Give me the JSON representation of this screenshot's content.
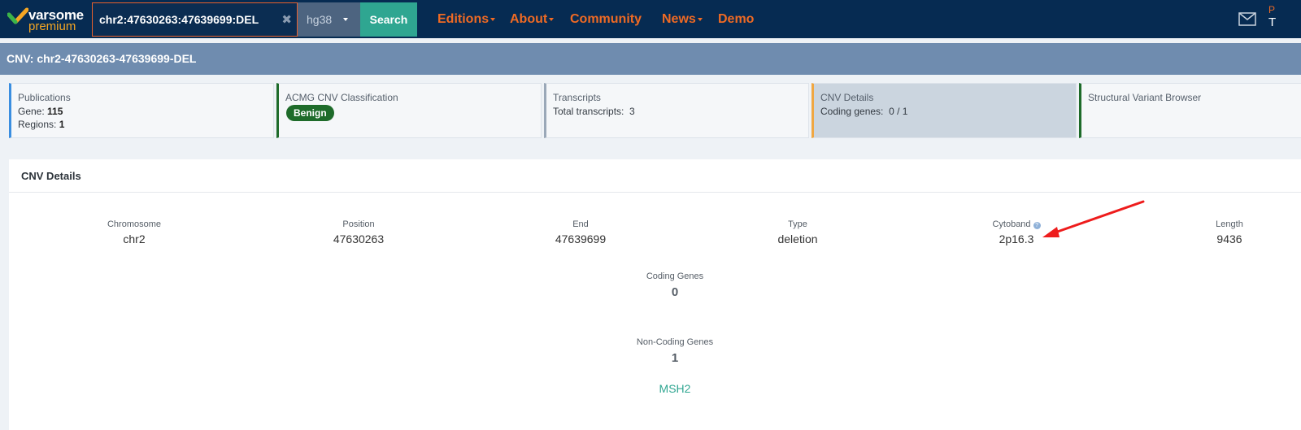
{
  "navbar": {
    "logo": {
      "name": "varsome",
      "edition": "premium"
    },
    "search": {
      "value": "chr2:47630263:47639699:DEL",
      "clear": "✖"
    },
    "genome": {
      "selected": "hg38"
    },
    "search_button": "Search",
    "menu": [
      {
        "label": "Editions",
        "dropdown": true
      },
      {
        "label": "About",
        "dropdown": true
      },
      {
        "label": "Community",
        "dropdown": false
      },
      {
        "label": "News",
        "dropdown": true
      },
      {
        "label": "Demo",
        "dropdown": false
      }
    ],
    "user_partial": {
      "line1": "P",
      "line2": "T"
    }
  },
  "page_title": "CNV: chr2-47630263-47639699-DEL",
  "cards": {
    "publications": {
      "title": "Publications",
      "gene_label": "Gene:",
      "gene_value": "115",
      "regions_label": "Regions:",
      "regions_value": "1"
    },
    "acmg": {
      "title": "ACMG CNV Classification",
      "badge": "Benign"
    },
    "transcripts": {
      "title": "Transcripts",
      "total_label": "Total transcripts:",
      "total_value": "3"
    },
    "cnv_details": {
      "title": "CNV Details",
      "coding_label": "Coding genes:",
      "coding_value": "0 / 1"
    },
    "sv_browser": {
      "title": "Structural Variant Browser"
    }
  },
  "details": {
    "title": "CNV Details",
    "chromosome": {
      "label": "Chromosome",
      "value": "chr2"
    },
    "position": {
      "label": "Position",
      "value": "47630263"
    },
    "end": {
      "label": "End",
      "value": "47639699"
    },
    "type": {
      "label": "Type",
      "value": "deletion"
    },
    "cytoband": {
      "label": "Cytoband",
      "value": "2p16.3",
      "help": "?"
    },
    "length": {
      "label": "Length",
      "value": "9436"
    },
    "coding_genes": {
      "label": "Coding Genes",
      "value": "0"
    },
    "non_coding_genes": {
      "label": "Non-Coding Genes",
      "value": "1"
    },
    "gene_link": "MSH2"
  },
  "colors": {
    "navbar_bg": "#062b52",
    "accent_orange": "#ef6a24",
    "search_green": "#2fa691",
    "title_bar": "#6f8caf",
    "benign_badge": "#1e6b2a",
    "annotation_arrow": "#ee1c1c"
  }
}
